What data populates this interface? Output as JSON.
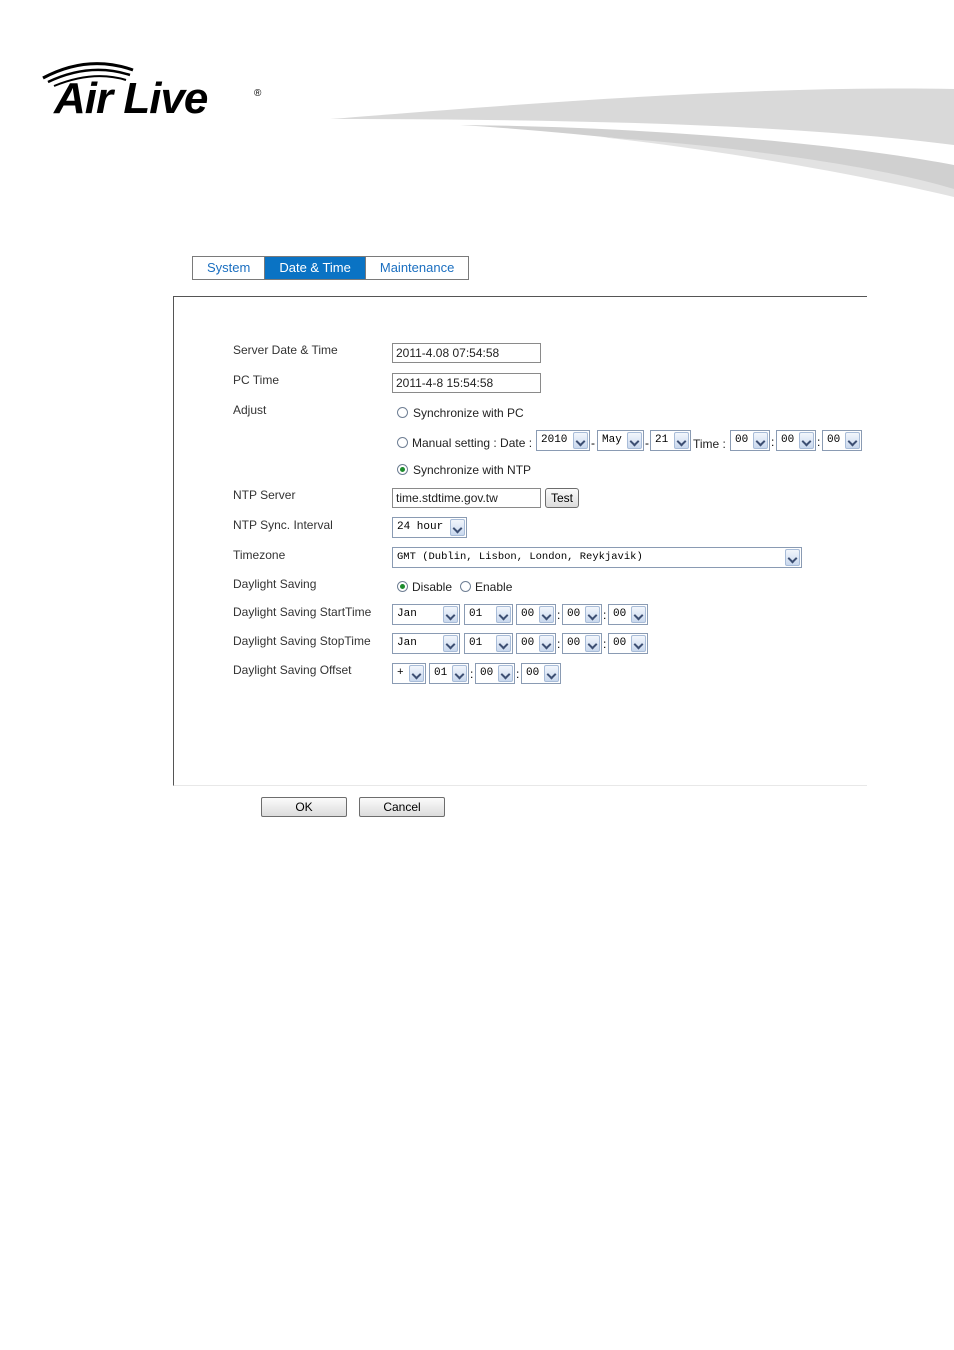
{
  "brand": {
    "name": "Air Live",
    "registered": "®"
  },
  "tabs": [
    {
      "label": "System",
      "active": false
    },
    {
      "label": "Date & Time",
      "active": true
    },
    {
      "label": "Maintenance",
      "active": false
    }
  ],
  "form": {
    "server_datetime": {
      "label": "Server Date & Time",
      "value": "2011-4.08 07:54:58"
    },
    "pc_time": {
      "label": "PC Time",
      "value": "2011-4-8 15:54:58"
    },
    "adjust": {
      "label": "Adjust",
      "sync_pc": "Synchronize with PC",
      "manual_label": "Manual setting : Date :",
      "time_label": "Time :",
      "date_year": "2010",
      "date_month": "May",
      "date_day": "21",
      "time_h": "00",
      "time_m": "00",
      "time_s": "00",
      "sync_ntp": "Synchronize with NTP",
      "selected": "Synchronize with NTP"
    },
    "ntp_server": {
      "label": "NTP Server",
      "value": "time.stdtime.gov.tw",
      "test_label": "Test"
    },
    "ntp_interval": {
      "label": "NTP Sync. Interval",
      "value": "24 hour"
    },
    "timezone": {
      "label": "Timezone",
      "value": "GMT (Dublin, Lisbon, London, Reykjavik)"
    },
    "daylight_saving": {
      "label": "Daylight Saving",
      "disable": "Disable",
      "enable": "Enable",
      "selected": "Disable"
    },
    "ds_start": {
      "label": "Daylight Saving StartTime",
      "month": "Jan",
      "day": "01",
      "h": "00",
      "m": "00",
      "s": "00"
    },
    "ds_stop": {
      "label": "Daylight Saving StopTime",
      "month": "Jan",
      "day": "01",
      "h": "00",
      "m": "00",
      "s": "00"
    },
    "ds_offset": {
      "label": "Daylight Saving Offset",
      "sign": "+",
      "h": "01",
      "m": "00",
      "s": "00"
    },
    "separators": {
      "dash": "-",
      "colon": ":"
    }
  },
  "buttons": {
    "ok": "OK",
    "cancel": "Cancel"
  }
}
